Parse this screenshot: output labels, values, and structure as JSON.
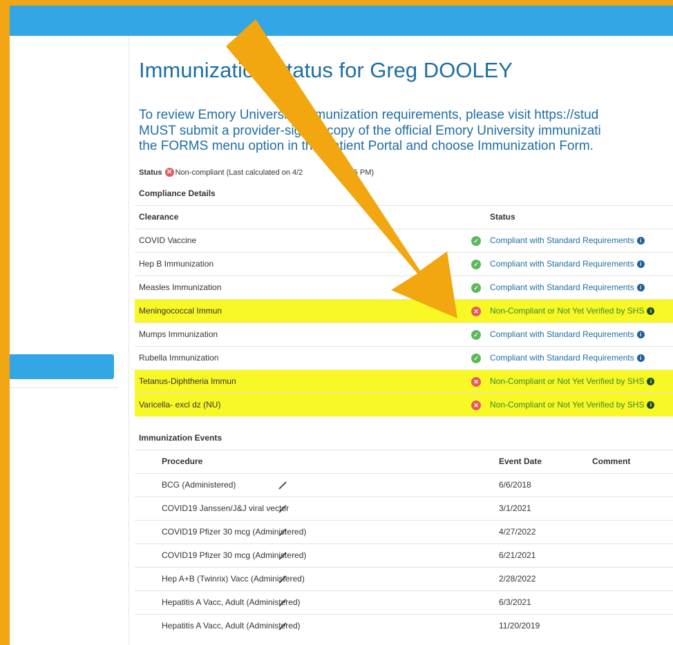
{
  "page": {
    "title": "Immunization Status for Greg DOOLEY",
    "intro_lines": [
      "To review Emory University immunization requirements, please visit https://stud",
      "MUST submit a provider-signed copy of the official Emory University immunizati",
      "the FORMS menu option in the Patient Portal and choose Immunization Form."
    ],
    "status_label": "Status",
    "status_text": "Non-compliant (Last calculated on 4/2",
    "status_time": "29:25 PM)"
  },
  "compliance": {
    "heading": "Compliance Details",
    "col_clearance": "Clearance",
    "col_status": "Status",
    "rows": [
      {
        "clearance": "COVID Vaccine",
        "status": "Compliant with Standard Requirements",
        "ok": true
      },
      {
        "clearance": "Hep B Immunization",
        "status": "Compliant with Standard Requirements",
        "ok": true
      },
      {
        "clearance": "Measles Immunization",
        "status": "Compliant with Standard Requirements",
        "ok": true
      },
      {
        "clearance": "Meningococcal Immun",
        "status": "Non-Compliant or Not Yet Verified by SHS",
        "ok": false
      },
      {
        "clearance": "Mumps Immunization",
        "status": "Compliant with Standard Requirements",
        "ok": true
      },
      {
        "clearance": "Rubella Immunization",
        "status": "Compliant with Standard Requirements",
        "ok": true
      },
      {
        "clearance": "Tetanus-Diphtheria Immun",
        "status": "Non-Compliant or Not Yet Verified by SHS",
        "ok": false
      },
      {
        "clearance": "Varicella- excl dz (NU)",
        "status": "Non-Compliant or Not Yet Verified by SHS",
        "ok": false
      }
    ]
  },
  "events": {
    "heading": "Immunization Events",
    "col_procedure": "Procedure",
    "col_date": "Event Date",
    "col_comment": "Comment",
    "rows": [
      {
        "procedure": "BCG (Administered)",
        "date": "6/6/2018"
      },
      {
        "procedure": "COVID19 Janssen/J&J viral vector",
        "date": "3/1/2021"
      },
      {
        "procedure": "COVID19 Pfizer 30 mcg (Administered)",
        "date": "4/27/2022"
      },
      {
        "procedure": "COVID19 Pfizer 30 mcg (Administered)",
        "date": "6/21/2021"
      },
      {
        "procedure": "Hep A+B (Twinrix) Vacc (Administered)",
        "date": "2/28/2022"
      },
      {
        "procedure": "Hepatitis A Vacc, Adult (Administered)",
        "date": "6/3/2021"
      },
      {
        "procedure": "Hepatitis A Vacc, Adult (Administered)",
        "date": "11/20/2019"
      }
    ]
  },
  "colors": {
    "header_blue": "#33a7e6",
    "frame_orange": "#f3a613",
    "highlight_yellow": "#f8f826",
    "title_blue": "#1f6ea3"
  },
  "icons": {
    "ok": "check-circle-icon",
    "bad": "x-circle-icon",
    "info": "info-circle-icon",
    "syringe": "syringe-icon",
    "annotation": "arrow-annotation"
  }
}
